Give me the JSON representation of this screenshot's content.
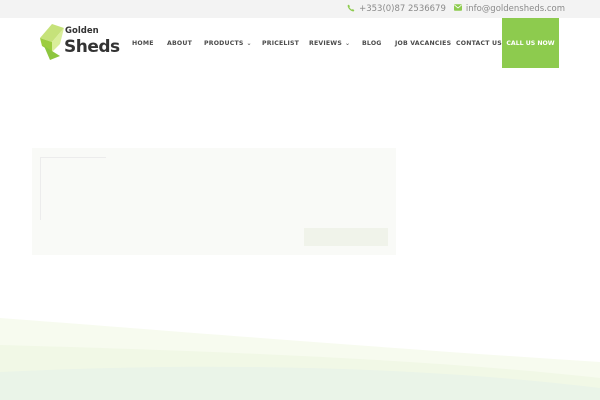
{
  "topbar": {
    "phone": "+353(0)87 2536679",
    "email": "info@goldensheds.com",
    "phone_icon": "phone-icon",
    "email_icon": "envelope-icon",
    "icon_color": "#8dcb4e"
  },
  "logo": {
    "line1": "Golden",
    "line2": "Sheds"
  },
  "nav": {
    "items": [
      {
        "label": "HOME",
        "has_dropdown": false
      },
      {
        "label": "ABOUT",
        "has_dropdown": false
      },
      {
        "label": "PRODUCTS",
        "has_dropdown": true
      },
      {
        "label": "PRICELIST",
        "has_dropdown": false
      },
      {
        "label": "REVIEWS",
        "has_dropdown": true
      },
      {
        "label": "BLOG",
        "has_dropdown": false
      },
      {
        "label": "JOB VACANCIES",
        "has_dropdown": false
      },
      {
        "label": "CONTACT US",
        "has_dropdown": false
      }
    ],
    "cta": "CALL US NOW",
    "cta_color": "#8dcb4e"
  },
  "hero": {
    "heading": "",
    "button": ""
  }
}
